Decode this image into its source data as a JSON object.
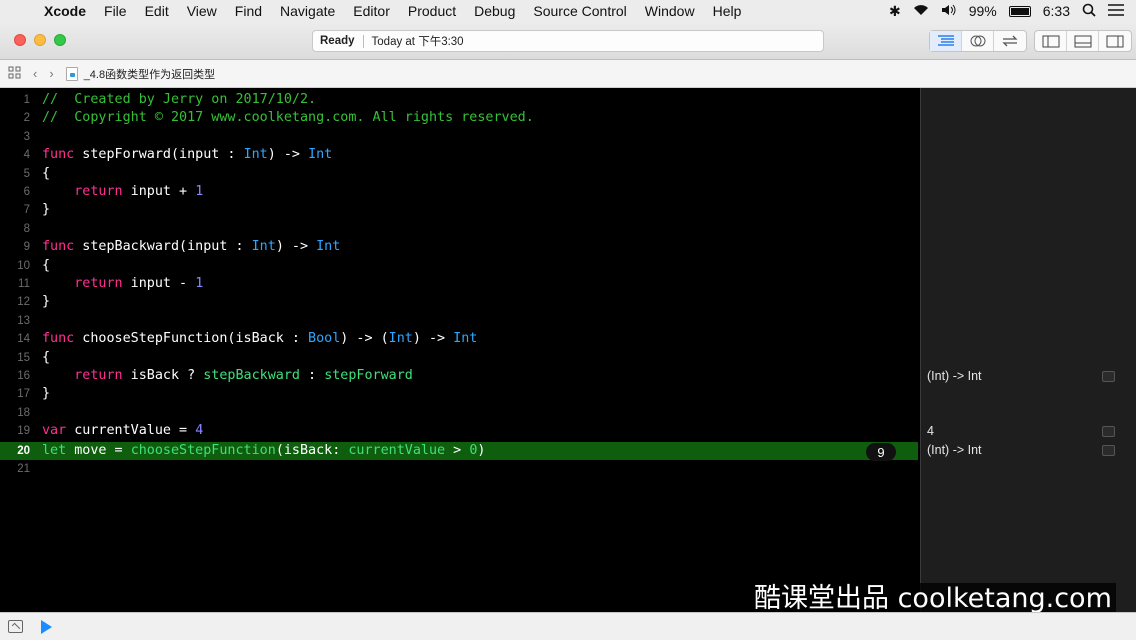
{
  "menubar": {
    "items": [
      "Xcode",
      "File",
      "Edit",
      "View",
      "Find",
      "Navigate",
      "Editor",
      "Product",
      "Debug",
      "Source Control",
      "Window",
      "Help"
    ],
    "battery": "99%",
    "time": "6:33"
  },
  "toolbar": {
    "status": "Ready",
    "timestamp": "Today at 下午3:30"
  },
  "jumpbar": {
    "file_name": "_4.8函数类型作为返回类型"
  },
  "editor": {
    "execution_count": "9",
    "line_numbers": [
      "1",
      "2",
      "3",
      "4",
      "5",
      "6",
      "7",
      "8",
      "9",
      "10",
      "11",
      "12",
      "13",
      "14",
      "15",
      "16",
      "17",
      "18",
      "19",
      "20",
      "21"
    ]
  },
  "results": {
    "line16": "(Int) -> Int",
    "line19": "4",
    "line20": "(Int) -> Int"
  },
  "watermark": "酷课堂出品 coolketang.com",
  "colors": {
    "keyword": "#ff2f92",
    "type": "#2ea6ff",
    "number": "#8b86ff",
    "comment": "#35c135",
    "current_line": "#0e5e0e"
  }
}
